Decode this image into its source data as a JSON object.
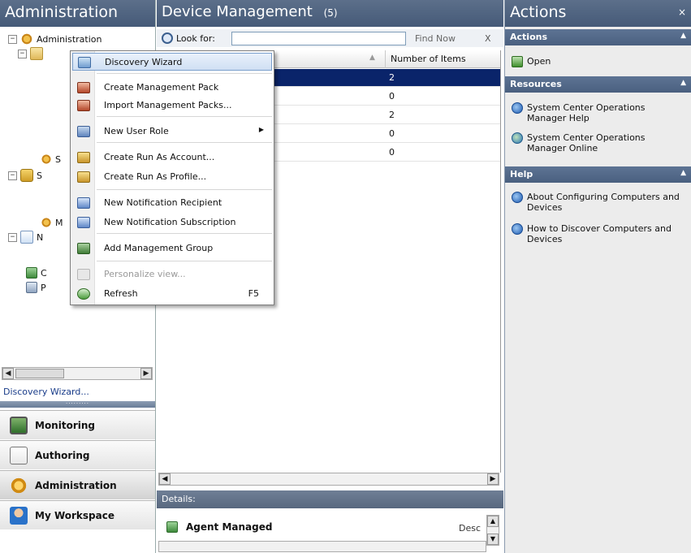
{
  "left_pane": {
    "title": "Administration",
    "tree": {
      "root_label": "Administration",
      "truncated_labels": [
        "S",
        "S",
        "M",
        "N",
        "C",
        "P"
      ]
    },
    "task_link": "Discovery Wizard...",
    "wunderbar": [
      {
        "label": "Monitoring",
        "icon": "monitoring-icon"
      },
      {
        "label": "Authoring",
        "icon": "authoring-icon"
      },
      {
        "label": "Administration",
        "icon": "administration-icon",
        "active": true
      },
      {
        "label": "My Workspace",
        "icon": "my-workspace-icon"
      }
    ]
  },
  "center_pane": {
    "title": "Device Management",
    "count": "(5)",
    "look_for_label": "Look for:",
    "search_value": "",
    "find_now_label": "Find Now",
    "clear_label": "X",
    "column_header": "Number of Items",
    "rows": [
      {
        "value": "2",
        "selected": true
      },
      {
        "value": "0"
      },
      {
        "value": "2"
      },
      {
        "value": "0"
      },
      {
        "value": "0"
      }
    ],
    "details_label": "Details:",
    "details_title": "Agent Managed",
    "details_desc": "Desc"
  },
  "context_menu": {
    "items": [
      {
        "label": "Discovery Wizard",
        "icon": "discovery-wizard-icon",
        "hover": true
      },
      {
        "label": "Create Management Pack",
        "icon": "management-pack-icon"
      },
      {
        "label": "Import Management Packs...",
        "icon": "import-pack-icon"
      },
      {
        "label": "New User Role",
        "icon": "user-role-icon",
        "submenu": true
      },
      {
        "label": "Create Run As Account...",
        "icon": "run-as-account-icon"
      },
      {
        "label": "Create Run As Profile...",
        "icon": "run-as-profile-icon"
      },
      {
        "label": "New Notification Recipient",
        "icon": "notification-recipient-icon"
      },
      {
        "label": "New Notification Subscription",
        "icon": "notification-subscription-icon"
      },
      {
        "label": "Add Management Group",
        "icon": "management-group-icon"
      },
      {
        "label": "Personalize view...",
        "icon": "personalize-view-icon",
        "disabled": true
      },
      {
        "label": "Refresh",
        "icon": "refresh-icon",
        "shortcut": "F5"
      }
    ]
  },
  "actions_pane": {
    "title": "Actions",
    "close_label": "×",
    "sections": [
      {
        "title": "Actions",
        "items": [
          "Open"
        ]
      },
      {
        "title": "Resources",
        "items": [
          "System Center Operations Manager Help",
          "System Center Operations Manager Online"
        ]
      },
      {
        "title": "Help",
        "items": [
          "About Configuring Computers and Devices",
          "How to Discover Computers and Devices"
        ]
      }
    ]
  }
}
